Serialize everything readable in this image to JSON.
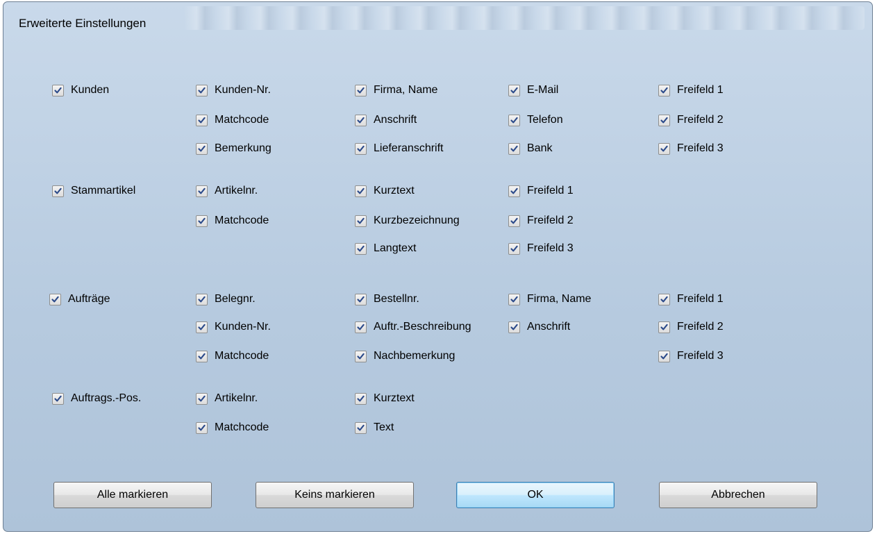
{
  "window": {
    "title": "Erweiterte Einstellungen"
  },
  "groups": [
    {
      "label": "Kunden",
      "checked": true,
      "fields": [
        "Kunden-Nr.",
        "Matchcode",
        "Bemerkung",
        "Firma, Name",
        "Anschrift",
        "Lieferanschrift",
        "E-Mail",
        "Telefon",
        "Bank",
        "Freifeld 1",
        "Freifeld 2",
        "Freifeld 3"
      ]
    },
    {
      "label": "Stammartikel",
      "checked": true,
      "fields": [
        "Artikelnr.",
        "Matchcode",
        "Kurztext",
        "Kurzbezeichnung",
        "Langtext",
        "Freifeld 1",
        "Freifeld 2",
        "Freifeld 3"
      ]
    },
    {
      "label": "Aufträge",
      "checked": true,
      "fields": [
        "Belegnr.",
        "Kunden-Nr.",
        "Matchcode",
        "Bestellnr.",
        "Auftr.-Beschreibung",
        "Nachbemerkung",
        "Firma, Name",
        "Anschrift",
        "Freifeld 1",
        "Freifeld 2",
        "Freifeld 3"
      ]
    },
    {
      "label": "Auftrags.-Pos.",
      "checked": true,
      "fields": [
        "Artikelnr.",
        "Matchcode",
        "Kurztext",
        "Text"
      ]
    }
  ],
  "buttons": {
    "select_all": "Alle markieren",
    "select_none": "Keins markieren",
    "ok": "OK",
    "cancel": "Abbrechen"
  }
}
